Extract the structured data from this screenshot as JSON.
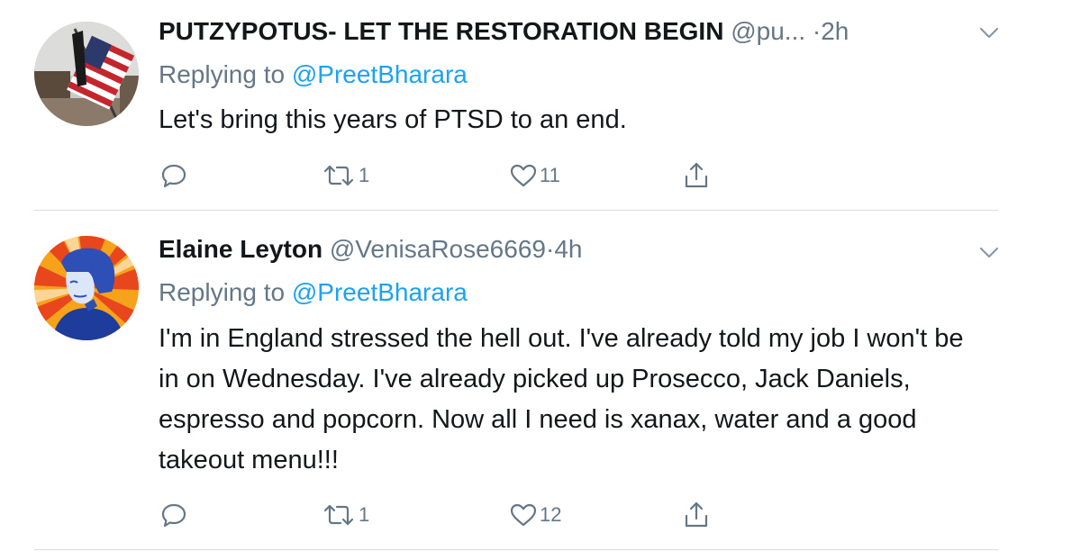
{
  "colors": {
    "text": "#14171a",
    "secondary": "#657786",
    "mention": "#1da1f2",
    "divider": "#d9dde1"
  },
  "tweets": [
    {
      "display_name": "PUTZYPOTUS- LET THE RESTORATION BEGIN",
      "handle": "@pu...",
      "separator": "·",
      "time": "2h",
      "replying_prefix": "Replying to ",
      "replying_to": "@PreetBharara",
      "text": "Let's bring this years of PTSD to an end.",
      "reply_icon": "reply-icon",
      "retweet_count": "1",
      "like_count": "11",
      "share_icon": "share-icon"
    },
    {
      "display_name": "Elaine Leyton",
      "handle": "@VenisaRose6669",
      "separator": "·",
      "time": "4h",
      "replying_prefix": "Replying to ",
      "replying_to": "@PreetBharara",
      "text": "I'm in England stressed the hell out. I've already told my job I won't be in on Wednesday. I've already picked up Prosecco, Jack Daniels, espresso and popcorn. Now all I need is xanax, water and a good takeout menu!!!",
      "reply_icon": "reply-icon",
      "retweet_count": "1",
      "like_count": "12",
      "share_icon": "share-icon"
    }
  ]
}
